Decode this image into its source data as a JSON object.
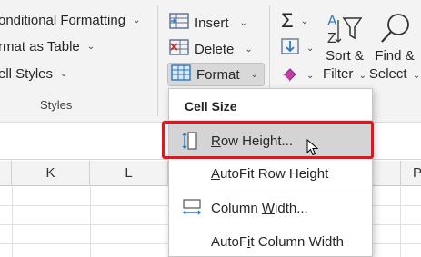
{
  "ribbon": {
    "styles_group": {
      "conditional_formatting": "onditional Formatting",
      "format_as_table": "rmat as Table",
      "cell_styles": "ell Styles",
      "label": "Styles"
    },
    "cells_group": {
      "insert": "Insert",
      "delete": "Delete",
      "format": "Format"
    },
    "editing_group": {
      "sort_filter_line1": "Sort &",
      "sort_filter_line2": "Filter",
      "find_select_line1": "Find &",
      "find_select_line2": "Select"
    }
  },
  "sheet": {
    "columns": [
      "K",
      "L",
      "P"
    ]
  },
  "menu": {
    "title": "Cell Size",
    "items": [
      {
        "label": "Row Height...",
        "underline": "R",
        "rest": "ow Height..."
      },
      {
        "label": "AutoFit Row Height",
        "underline": "A",
        "rest": "utoFit Row Height"
      },
      {
        "label": "Column Width...",
        "pre": "Column ",
        "underline": "W",
        "rest": "idth..."
      },
      {
        "label": "AutoFit Column Width",
        "pre": "AutoF",
        "underline": "i",
        "rest": "t Column Width"
      }
    ]
  },
  "colors": {
    "ribbon_bg": "#f3f3f3",
    "highlight": "#d4d4d4",
    "callout_red": "#e8131a",
    "icon_blue": "#2b78c5"
  }
}
